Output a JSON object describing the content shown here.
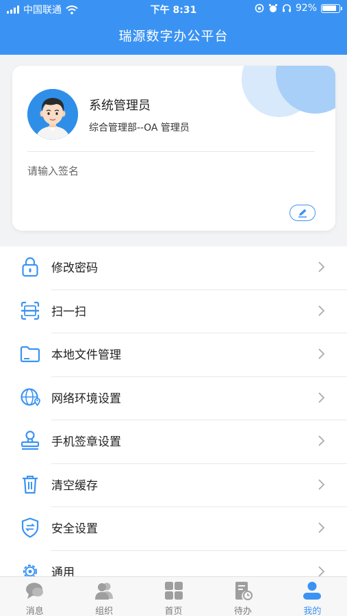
{
  "status_bar": {
    "carrier": "中国联通",
    "time": "下午 8:31",
    "battery_text": "92%",
    "battery_level": 0.92
  },
  "header": {
    "title": "瑞源数字办公平台"
  },
  "profile": {
    "name": "系统管理员",
    "department": "综合管理部--OA 管理员",
    "signature_placeholder": "请输入签名"
  },
  "menu": {
    "items": [
      {
        "label": "修改密码",
        "icon": "lock-icon"
      },
      {
        "label": "扫一扫",
        "icon": "scan-icon"
      },
      {
        "label": "本地文件管理",
        "icon": "folder-icon"
      },
      {
        "label": "网络环境设置",
        "icon": "globe-icon"
      },
      {
        "label": "手机签章设置",
        "icon": "seal-icon"
      },
      {
        "label": "清空缓存",
        "icon": "trash-icon"
      },
      {
        "label": "安全设置",
        "icon": "shield-icon"
      },
      {
        "label": "通用",
        "icon": "gear-icon"
      }
    ]
  },
  "tabbar": {
    "tabs": [
      {
        "label": "消息",
        "icon": "chat-icon"
      },
      {
        "label": "组织",
        "icon": "contacts-icon"
      },
      {
        "label": "首页",
        "icon": "grid-icon"
      },
      {
        "label": "待办",
        "icon": "todo-icon"
      },
      {
        "label": "我的",
        "icon": "user-icon"
      }
    ],
    "active_index": 4
  },
  "colors": {
    "primary": "#3a93f3",
    "icon_gray": "#9e9e9e",
    "text": "#222222"
  }
}
